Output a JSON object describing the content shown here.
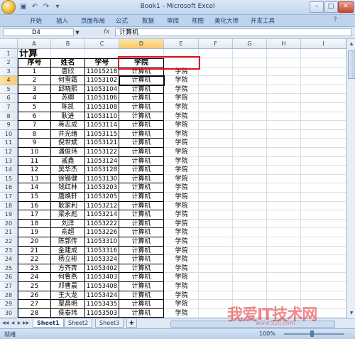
{
  "window": {
    "title": "Book1 - Microsoft Excel"
  },
  "ribbon": {
    "tabs": [
      "开始",
      "插入",
      "页面布局",
      "公式",
      "数据",
      "审阅",
      "视图",
      "美化大师",
      "开发工具"
    ]
  },
  "formula_bar": {
    "name_box": "D4",
    "fx": "fx",
    "content": "计算机"
  },
  "columns": [
    "A",
    "B",
    "C",
    "D",
    "E",
    "F",
    "G",
    "H",
    "I"
  ],
  "row_numbers": [
    "1",
    "2",
    "3",
    "4",
    "5",
    "6",
    "7",
    "8",
    "9",
    "10",
    "11",
    "12",
    "13",
    "14",
    "15",
    "16",
    "17",
    "18",
    "19",
    "20",
    "21",
    "22",
    "23",
    "24",
    "25",
    "26",
    "27",
    "28",
    "29",
    "30"
  ],
  "sheet": {
    "title": "计算",
    "headers": [
      "序号",
      "姓名",
      "学号",
      "学院"
    ],
    "rows": [
      [
        "1",
        "唐欣",
        "11015218",
        "计算机",
        "学院"
      ],
      [
        "2",
        "何雪霜",
        "11053102",
        "计算机",
        "学院"
      ],
      [
        "3",
        "邱晓熙",
        "11053104",
        "计算机",
        "学院"
      ],
      [
        "4",
        "苏卿",
        "11053106",
        "计算机",
        "学院"
      ],
      [
        "5",
        "陈凯",
        "11053108",
        "计算机",
        "学院"
      ],
      [
        "6",
        "耿进",
        "11053110",
        "计算机",
        "学院"
      ],
      [
        "7",
        "蒋志成",
        "11053114",
        "计算机",
        "学院"
      ],
      [
        "8",
        "井光绪",
        "11053115",
        "计算机",
        "学院"
      ],
      [
        "9",
        "倪世斌",
        "11053121",
        "计算机",
        "学院"
      ],
      [
        "10",
        "潘俊玮",
        "11053122",
        "计算机",
        "学院"
      ],
      [
        "11",
        "戚鑫",
        "11053124",
        "计算机",
        "学院"
      ],
      [
        "12",
        "吴华杰",
        "11053128",
        "计算机",
        "学院"
      ],
      [
        "13",
        "徐锡健",
        "11053130",
        "计算机",
        "学院"
      ],
      [
        "14",
        "钱红林",
        "11053203",
        "计算机",
        "学院"
      ],
      [
        "15",
        "唐焕轩",
        "11053205",
        "计算机",
        "学院"
      ],
      [
        "16",
        "耿家利",
        "11053212",
        "计算机",
        "学院"
      ],
      [
        "17",
        "梁永彪",
        "11053214",
        "计算机",
        "学院"
      ],
      [
        "18",
        "刘洋",
        "11053222",
        "计算机",
        "学院"
      ],
      [
        "19",
        "俞超",
        "11053226",
        "计算机",
        "学院"
      ],
      [
        "20",
        "陈郭传",
        "11053310",
        "计算机",
        "学院"
      ],
      [
        "21",
        "金建成",
        "11053316",
        "计算机",
        "学院"
      ],
      [
        "22",
        "杨立彬",
        "11053324",
        "计算机",
        "学院"
      ],
      [
        "23",
        "方齐奔",
        "11053402",
        "计算机",
        "学院"
      ],
      [
        "24",
        "何鲁燕",
        "11053403",
        "计算机",
        "学院"
      ],
      [
        "25",
        "邓曹晨",
        "11053408",
        "计算机",
        "学院"
      ],
      [
        "26",
        "王大龙",
        "11053424",
        "计算机",
        "学院"
      ],
      [
        "27",
        "覃昌明",
        "11053435",
        "计算机",
        "学院"
      ],
      [
        "28",
        "侯泰玮",
        "11053503",
        "计算机",
        "学院"
      ]
    ]
  },
  "sheet_tabs": [
    "Sheet1",
    "Sheet2",
    "Sheet3"
  ],
  "status": {
    "text": "就绪",
    "zoom": "100%"
  },
  "watermark": {
    "text": "我爱IT技术网",
    "sub": "www.52ij.com"
  },
  "colors": {
    "highlight_border": "#e00d1e",
    "selection_header": "#f8c86c"
  }
}
